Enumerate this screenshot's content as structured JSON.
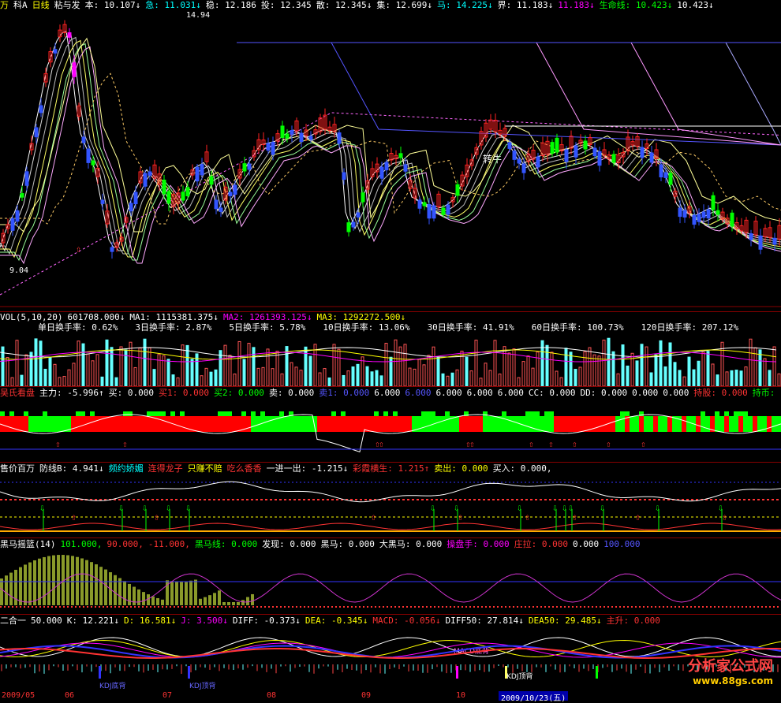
{
  "main": {
    "header": {
      "items": [
        {
          "label": "万",
          "color": "y"
        },
        {
          "label": "科A",
          "color": "w"
        },
        {
          "label": "日线",
          "color": "y"
        },
        {
          "label": "粘与发",
          "color": "w"
        },
        {
          "label": "本: 10.107↓",
          "color": "w"
        },
        {
          "label": "急: 11.031↓",
          "color": "c"
        },
        {
          "label": "稳: 12.186",
          "color": "w"
        },
        {
          "label": "投: 12.345",
          "color": "w"
        },
        {
          "label": "散: 12.345↓",
          "color": "w"
        },
        {
          "label": "集: 12.699↓",
          "color": "w"
        },
        {
          "label": "马: 14.225↓",
          "color": "c"
        },
        {
          "label": "界: 11.183↓",
          "color": "w"
        },
        {
          "label": "11.183↓",
          "color": "m"
        },
        {
          "label": "生命线: 10.423↓",
          "color": "g"
        },
        {
          "label": "10.423↓",
          "color": "w"
        }
      ]
    },
    "high_label": "14.94",
    "low_label": "9.04",
    "annotation": "转牛"
  },
  "vol": {
    "header": [
      {
        "label": "VOL(5,10,20)",
        "color": "w"
      },
      {
        "label": "601708.000↓",
        "color": "w"
      },
      {
        "label": "MA1: 1115381.375↓",
        "color": "w"
      },
      {
        "label": "MA2: 1261393.125↓",
        "color": "m"
      },
      {
        "label": "MA3: 1292272.500↓",
        "color": "y"
      }
    ],
    "turnover": [
      {
        "label": "单日换手率: 0.62%"
      },
      {
        "label": "3日换手率: 2.87%"
      },
      {
        "label": "5日换手率: 5.78%"
      },
      {
        "label": "10日换手率: 13.06%"
      },
      {
        "label": "30日换手率: 41.91%"
      },
      {
        "label": "60日换手率: 100.73%"
      },
      {
        "label": "120日换手率: 207.12%"
      }
    ]
  },
  "wu": {
    "header": [
      {
        "label": "吴氏看盘",
        "color": "r"
      },
      {
        "label": "主力: -5.996↑",
        "color": "w"
      },
      {
        "label": "买: 0.000",
        "color": "w"
      },
      {
        "label": "买1: 0.000",
        "color": "r"
      },
      {
        "label": "买2: 0.000",
        "color": "g"
      },
      {
        "label": "卖: 0.000",
        "color": "w"
      },
      {
        "label": "卖1: 0.000",
        "color": "b"
      },
      {
        "label": "6.000",
        "color": "w"
      },
      {
        "label": "6.000",
        "color": "b"
      },
      {
        "label": "6.000",
        "color": "w"
      },
      {
        "label": "6.000",
        "color": "w"
      },
      {
        "label": "6.000",
        "color": "w"
      },
      {
        "label": "CC: 0.000",
        "color": "w"
      },
      {
        "label": "DD: 0.000",
        "color": "w"
      },
      {
        "label": "0.000",
        "color": "w"
      },
      {
        "label": "0.000",
        "color": "w"
      },
      {
        "label": "持股: 0.000",
        "color": "r"
      },
      {
        "label": "持币: -",
        "color": "g"
      }
    ]
  },
  "sell": {
    "header": [
      {
        "label": "售价百万",
        "color": "w"
      },
      {
        "label": "防线B: 4.941↓",
        "color": "w"
      },
      {
        "label": "频约娇媚",
        "color": "c"
      },
      {
        "label": "连得龙子",
        "color": "r"
      },
      {
        "label": "只赚不赔",
        "color": "y"
      },
      {
        "label": "吃么香香",
        "color": "r"
      },
      {
        "label": "一进一出: -1.215↓",
        "color": "w"
      },
      {
        "label": "彩霞横生: 1.215↑",
        "color": "r"
      },
      {
        "label": "卖出: 0.000",
        "color": "y"
      },
      {
        "label": "买入: 0.000,",
        "color": "w"
      }
    ]
  },
  "horse": {
    "header": [
      {
        "label": "黑马摇篮(14)",
        "color": "w"
      },
      {
        "label": "101.000,",
        "color": "g"
      },
      {
        "label": "90.000,",
        "color": "r"
      },
      {
        "label": "-11.000,",
        "color": "r"
      },
      {
        "label": "黑马线: 0.000",
        "color": "g"
      },
      {
        "label": "发现: 0.000",
        "color": "w"
      },
      {
        "label": "黑马: 0.000",
        "color": "w"
      },
      {
        "label": "大黑马: 0.000",
        "color": "w"
      },
      {
        "label": "操盘手: 0.000",
        "color": "m"
      },
      {
        "label": "庄拉: 0.000",
        "color": "r"
      },
      {
        "label": "0.000",
        "color": "w"
      },
      {
        "label": "100.000",
        "color": "b"
      }
    ]
  },
  "kdj": {
    "header": [
      {
        "label": "二合一",
        "color": "w"
      },
      {
        "label": "50.000",
        "color": "w"
      },
      {
        "label": "K: 12.221↓",
        "color": "w"
      },
      {
        "label": "D: 16.581↓",
        "color": "y"
      },
      {
        "label": "J: 3.500↓",
        "color": "m"
      },
      {
        "label": "DIFF: -0.373↓",
        "color": "w"
      },
      {
        "label": "DEA: -0.345↓",
        "color": "y"
      },
      {
        "label": "MACD: -0.056↓",
        "color": "r"
      },
      {
        "label": "DIFF50: 27.814↓",
        "color": "w"
      },
      {
        "label": "DEA50: 29.485↓",
        "color": "y"
      },
      {
        "label": "主升: 0.000",
        "color": "r"
      }
    ],
    "signals": [
      "KDJ底背",
      "KDJ顶背",
      "MACD底背",
      "KDJ顶背"
    ]
  },
  "xaxis": {
    "labels": [
      "2009/05",
      "06",
      "07",
      "08",
      "09",
      "10"
    ],
    "current_date": "2009/10/23(五)"
  },
  "watermark": {
    "title": "分析家公式网",
    "url": "www.88gs.com"
  }
}
